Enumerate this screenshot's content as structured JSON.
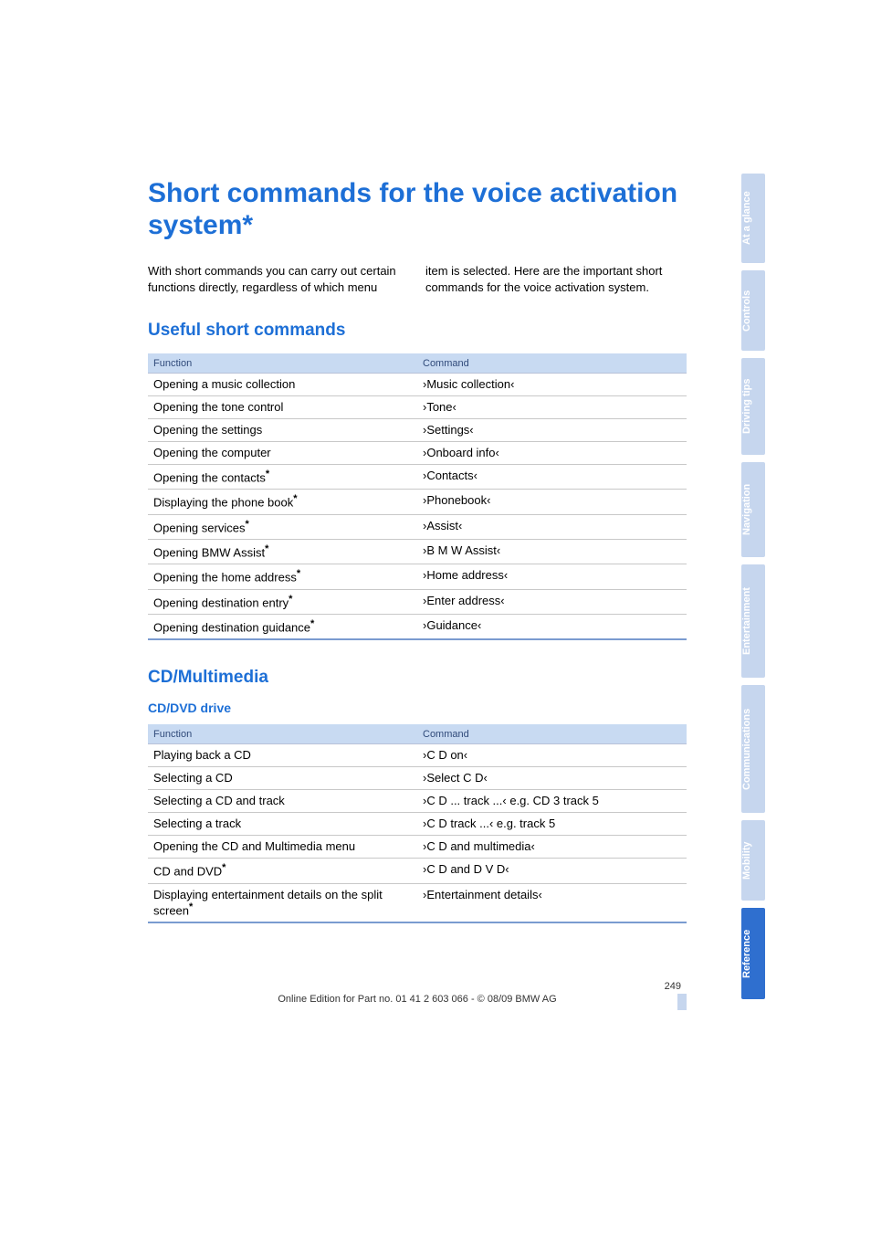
{
  "title": "Short commands for the voice activation system*",
  "intro_left": "With short commands you can carry out certain functions directly, regardless of which menu",
  "intro_right": "item is selected. Here are the important short commands for the voice activation system.",
  "section1": {
    "heading": "Useful short commands",
    "header_func": "Function",
    "header_cmd": "Command",
    "rows": [
      {
        "func": "Opening a music collection",
        "star": false,
        "cmd": "›Music collection‹"
      },
      {
        "func": "Opening the tone control",
        "star": false,
        "cmd": "›Tone‹"
      },
      {
        "func": "Opening the settings",
        "star": false,
        "cmd": "›Settings‹"
      },
      {
        "func": "Opening the computer",
        "star": false,
        "cmd": "›Onboard info‹"
      },
      {
        "func": "Opening the contacts",
        "star": true,
        "cmd": "›Contacts‹"
      },
      {
        "func": "Displaying the phone book",
        "star": true,
        "cmd": "›Phonebook‹"
      },
      {
        "func": "Opening services",
        "star": true,
        "cmd": "›Assist‹"
      },
      {
        "func": "Opening BMW Assist",
        "star": true,
        "cmd": "›B M W Assist‹"
      },
      {
        "func": "Opening the home address",
        "star": true,
        "cmd": "›Home address‹"
      },
      {
        "func": "Opening destination entry",
        "star": true,
        "cmd": "›Enter address‹"
      },
      {
        "func": "Opening destination guidance",
        "star": true,
        "cmd": "›Guidance‹"
      }
    ]
  },
  "section2": {
    "heading": "CD/Multimedia",
    "subheading": "CD/DVD drive",
    "header_func": "Function",
    "header_cmd": "Command",
    "rows": [
      {
        "func": "Playing back a CD",
        "star": false,
        "cmd": "›C D on‹"
      },
      {
        "func": "Selecting a CD",
        "star": false,
        "cmd": "›Select C D‹"
      },
      {
        "func": "Selecting a CD and track",
        "star": false,
        "cmd": "›C D ... track ...‹ e.g. CD 3 track 5"
      },
      {
        "func": "Selecting a track",
        "star": false,
        "cmd": "›C D track ...‹ e.g. track 5"
      },
      {
        "func": "Opening the CD and Multimedia menu",
        "star": false,
        "cmd": "›C D and multimedia‹"
      },
      {
        "func": "CD and DVD",
        "star": true,
        "cmd": "›C D and D V D‹"
      },
      {
        "func": "Displaying entertainment details on the split screen",
        "star": true,
        "cmd": "›Entertainment details‹"
      }
    ]
  },
  "tabs": [
    {
      "label": "At a glance",
      "active": false
    },
    {
      "label": "Controls",
      "active": false
    },
    {
      "label": "Driving tips",
      "active": false
    },
    {
      "label": "Navigation",
      "active": false
    },
    {
      "label": "Entertainment",
      "active": false
    },
    {
      "label": "Communications",
      "active": false
    },
    {
      "label": "Mobility",
      "active": false
    },
    {
      "label": "Reference",
      "active": true
    }
  ],
  "footer": {
    "page": "249",
    "edition": "Online Edition for Part no. 01 41 2 603 066 - © 08/09 BMW AG"
  }
}
